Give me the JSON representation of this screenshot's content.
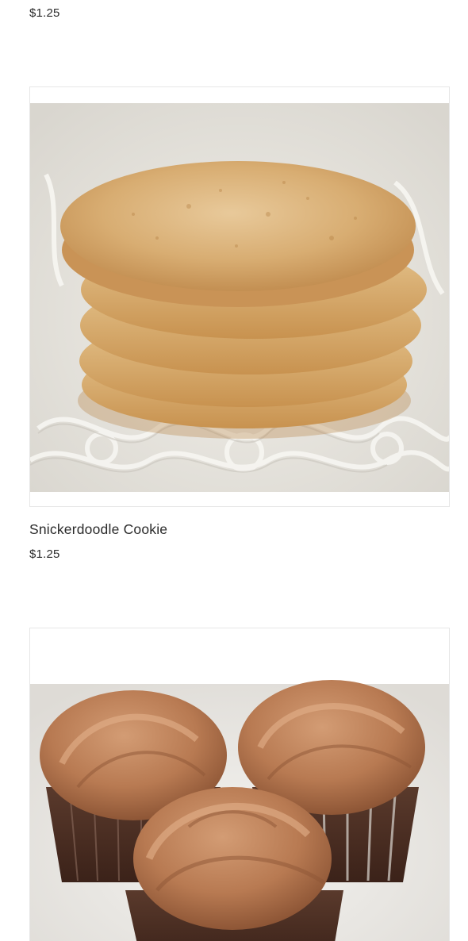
{
  "products": [
    {
      "name": "",
      "price": "$1.25"
    },
    {
      "name": "Snickerdoodle Cookie",
      "price": "$1.25"
    },
    {
      "name": "",
      "price": ""
    }
  ],
  "images": {
    "cookie": "snickerdoodle-cookie-stack-photo",
    "cupcake": "chocolate-cupcakes-photo"
  },
  "colors": {
    "text": "#2b2b2b",
    "border": "#e6e6e6",
    "background": "#ffffff"
  }
}
